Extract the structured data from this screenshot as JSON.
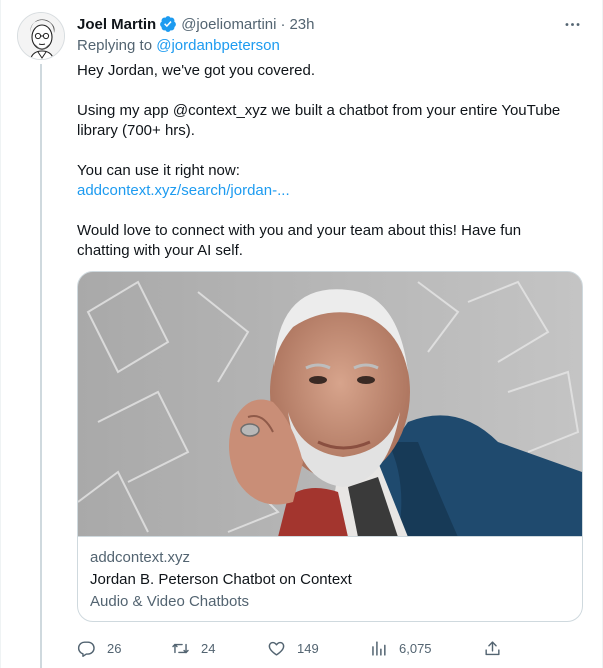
{
  "tweet": {
    "author_name": "Joel Martin",
    "handle": "@joeliomartini",
    "separator": "·",
    "time": "23h",
    "replying_prefix": "Replying to",
    "replying_handle": "@jordanbpeterson",
    "lines": {
      "p1": "Hey Jordan, we've got you covered.",
      "p2a": "Using my app @context_xyz we built a chatbot from your entire YouTube",
      "p2b": "library (700+ hrs).",
      "p3a": "You can use it right now:",
      "p3_link": "addcontext.xyz/search/jordan-...",
      "p4a": "Would love to connect with you and your team about this! Have fun",
      "p4b": "chatting with your AI self."
    }
  },
  "card": {
    "domain": "addcontext.xyz",
    "title": "Jordan B. Peterson Chatbot on Context",
    "description": "Audio & Video Chatbots"
  },
  "actions": {
    "replies": "26",
    "retweets": "24",
    "likes": "149",
    "views": "6,075"
  },
  "icons": {
    "verified": "verified-badge-icon",
    "more": "more-options-icon",
    "reply": "reply-icon",
    "retweet": "retweet-icon",
    "like": "like-icon",
    "views": "views-icon",
    "share": "share-icon"
  },
  "colors": {
    "accent": "#1d9bf0",
    "secondary_text": "#536471",
    "primary_text": "#0f1419",
    "border": "#cfd9de"
  }
}
